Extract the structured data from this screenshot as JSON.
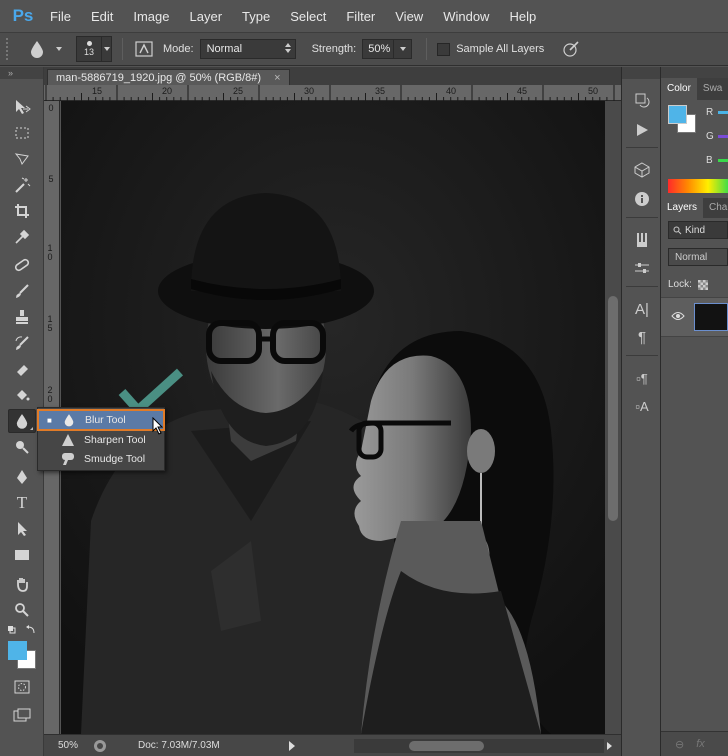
{
  "app": {
    "logo": "Ps",
    "menu": [
      "File",
      "Edit",
      "Image",
      "Layer",
      "Type",
      "Select",
      "Filter",
      "View",
      "Window",
      "Help"
    ]
  },
  "options": {
    "brush_size": "13",
    "mode_label": "Mode:",
    "mode_value": "Normal",
    "strength_label": "Strength:",
    "strength_value": "50%",
    "sample_all_layers": "Sample All Layers",
    "sample_all_checked": false
  },
  "document": {
    "tab_title": "man-5886719_1920.jpg @ 50% (RGB/8#)",
    "close": "×",
    "ruler_top": [
      "15",
      "20",
      "25",
      "30",
      "35",
      "40",
      "45",
      "50"
    ],
    "ruler_left": [
      "0",
      "5",
      "1 0",
      "1 5",
      "2 0"
    ]
  },
  "status": {
    "zoom": "50%",
    "doc_info": "Doc: 7.03M/7.03M"
  },
  "flyout": {
    "items": [
      {
        "label": "Blur Tool",
        "icon": "blur-drop-icon",
        "selected": true
      },
      {
        "label": "Sharpen Tool",
        "icon": "sharpen-triangle-icon",
        "selected": false
      },
      {
        "label": "Smudge Tool",
        "icon": "smudge-finger-icon",
        "selected": false
      }
    ],
    "bullet": "■"
  },
  "panels": {
    "color_tabs": [
      "Color",
      "Swa"
    ],
    "rgb_labels": [
      "R",
      "G",
      "B"
    ],
    "layers_tabs": [
      "Layers",
      "Cha"
    ],
    "kind_label": "Kind",
    "blend_mode": "Normal",
    "lock_label": "Lock:"
  },
  "colors": {
    "foreground": "#4fb4e8",
    "background": "#ffffff",
    "highlight_border": "#e07b28",
    "checkmark": "#4a8f83"
  }
}
